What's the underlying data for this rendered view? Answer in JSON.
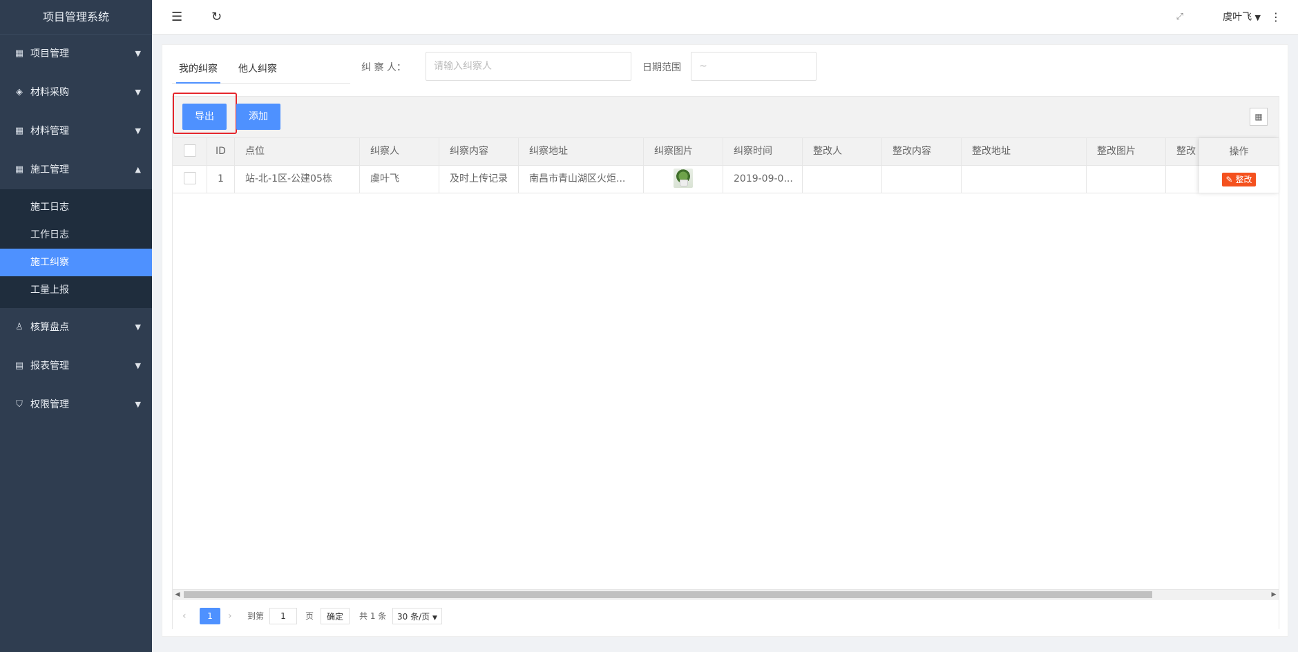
{
  "brand": {
    "title": "项目管理系统"
  },
  "sidebar": {
    "items": [
      {
        "label": "项目管理",
        "icon": "grid-icon"
      },
      {
        "label": "材料采购",
        "icon": "layers-icon"
      },
      {
        "label": "材料管理",
        "icon": "grid-icon"
      },
      {
        "label": "施工管理",
        "icon": "grid-icon"
      },
      {
        "label": "核算盘点",
        "icon": "user-icon"
      },
      {
        "label": "报表管理",
        "icon": "report-icon"
      },
      {
        "label": "权限管理",
        "icon": "shield-icon"
      }
    ],
    "submenu": [
      "施工日志",
      "工作日志",
      "施工纠察",
      "工量上报"
    ]
  },
  "topbar": {
    "user": "虞叶飞"
  },
  "tabs": [
    "我的纠察",
    "他人纠察"
  ],
  "filters": {
    "inspector_label": "纠 察 人：",
    "inspector_placeholder": "请输入纠察人",
    "date_label": "日期范围",
    "date_placeholder": "~"
  },
  "toolbar": {
    "export_label": "导出",
    "add_label": "添加"
  },
  "table": {
    "columns": [
      "ID",
      "点位",
      "纠察人",
      "纠察内容",
      "纠察地址",
      "纠察图片",
      "纠察时间",
      "整改人",
      "整改内容",
      "整改地址",
      "整改图片",
      "整改"
    ],
    "action_column": "操作",
    "rows": [
      {
        "id": "1",
        "location": "站-北-1区-公建05栋",
        "inspector": "虞叶飞",
        "content": "及时上传记录",
        "address": "南昌市青山湖区火炬...",
        "time": "2019-09-0...",
        "fixer": "",
        "fix_content": "",
        "fix_address": "",
        "action_label": "整改"
      }
    ]
  },
  "pager": {
    "current": "1",
    "goto_prefix": "到第",
    "goto_value": "1",
    "goto_suffix": "页",
    "confirm": "确定",
    "total": "共 1 条",
    "page_size": "30 条/页"
  }
}
